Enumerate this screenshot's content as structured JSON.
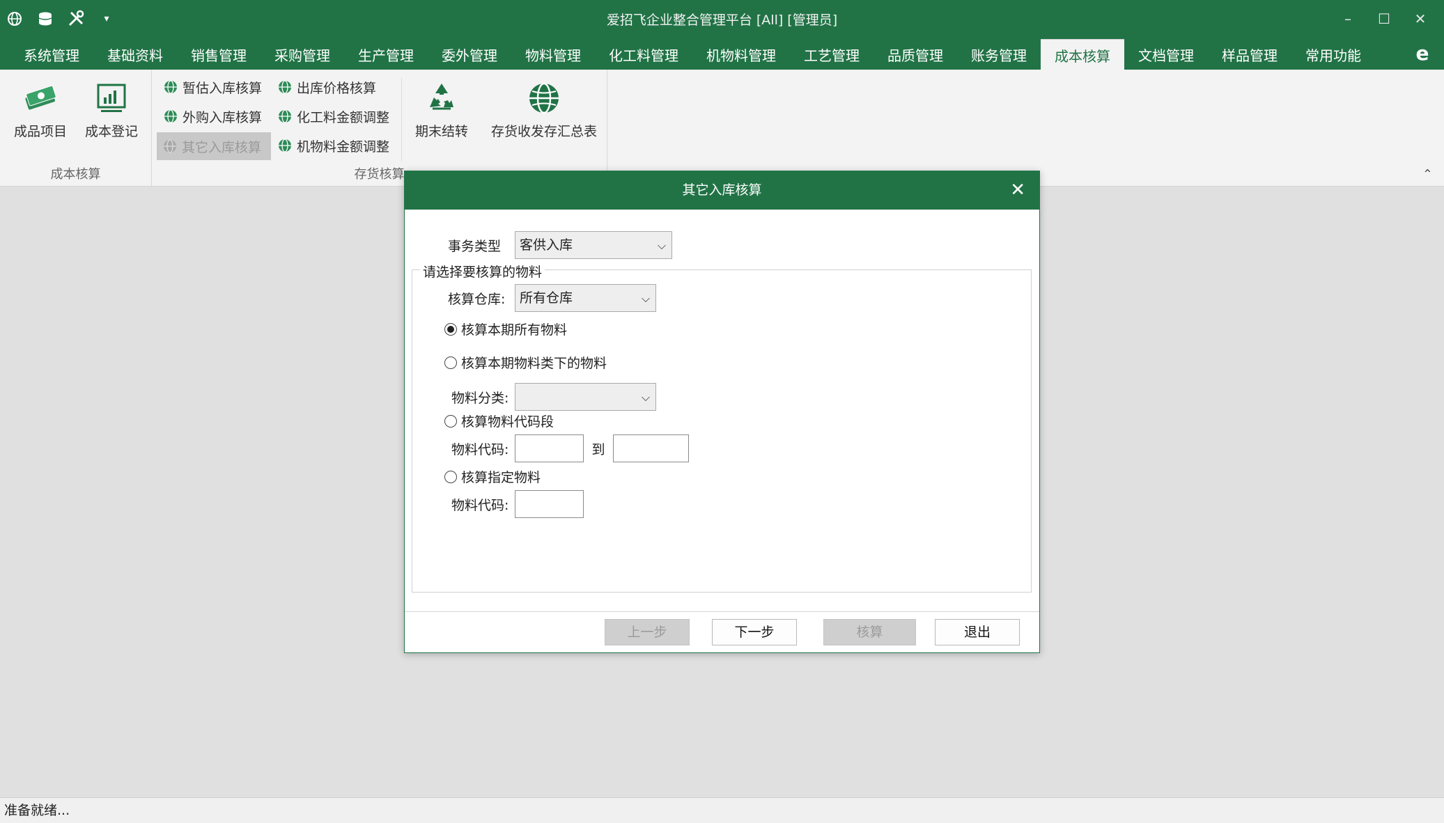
{
  "window": {
    "title": "爱招飞企业整合管理平台 [All] [管理员]",
    "controls": {
      "minimize": "–",
      "maximize": "☐",
      "close": "✕"
    }
  },
  "quick_access": [
    "globe-icon",
    "database-icon",
    "tools-icon",
    "dropdown-icon"
  ],
  "menu": {
    "tabs": [
      {
        "label": "系统管理"
      },
      {
        "label": "基础资料"
      },
      {
        "label": "销售管理"
      },
      {
        "label": "采购管理"
      },
      {
        "label": "生产管理"
      },
      {
        "label": "委外管理"
      },
      {
        "label": "物料管理"
      },
      {
        "label": "化工料管理"
      },
      {
        "label": "机物料管理"
      },
      {
        "label": "工艺管理"
      },
      {
        "label": "品质管理"
      },
      {
        "label": "账务管理"
      },
      {
        "label": "成本核算",
        "active": true
      },
      {
        "label": "文档管理"
      },
      {
        "label": "样品管理"
      },
      {
        "label": "常用功能"
      }
    ],
    "brand_glyph": "e"
  },
  "ribbon": {
    "group1": {
      "label": "成本核算",
      "buttons": [
        {
          "label": "成品项目",
          "icon": "money-icon"
        },
        {
          "label": "成本登记",
          "icon": "chart-icon"
        }
      ]
    },
    "group2": {
      "label": "存货核算",
      "small_buttons": [
        {
          "label": "暂估入库核算",
          "icon": "globe-icon"
        },
        {
          "label": "外购入库核算",
          "icon": "globe-icon"
        },
        {
          "label": "其它入库核算",
          "icon": "globe-icon",
          "disabled": true
        },
        {
          "label": "出库价格核算",
          "icon": "globe-icon"
        },
        {
          "label": "化工料金额调整",
          "icon": "globe-icon"
        },
        {
          "label": "机物料金额调整",
          "icon": "globe-icon"
        }
      ],
      "big_buttons": [
        {
          "label": "期末结转",
          "icon": "recycle-icon"
        },
        {
          "label": "存货收发存汇总表",
          "icon": "globe-icon"
        }
      ]
    },
    "collapse_glyph": "⌃"
  },
  "dialog": {
    "title": "其它入库核算",
    "close": "✕",
    "transaction_type_label": "事务类型",
    "transaction_type_value": "客供入库",
    "group_legend": "请选择要核算的物料",
    "warehouse_label": "核算仓库:",
    "warehouse_value": "所有仓库",
    "option_all": "核算本期所有物料",
    "option_category": "核算本期物料类下的物料",
    "category_label": "物料分类:",
    "category_value": "",
    "option_code_range": "核算物料代码段",
    "code_label": "物料代码:",
    "code_to": "到",
    "code_from_value": "",
    "code_to_value": "",
    "option_specified": "核算指定物料",
    "specified_code_label": "物料代码:",
    "specified_code_value": "",
    "buttons": {
      "prev": "上一步",
      "next": "下一步",
      "calc": "核算",
      "exit": "退出"
    }
  },
  "status": {
    "text": "准备就绪..."
  },
  "colors": {
    "brand": "#217346",
    "ribbon_bg": "#f3f3f3",
    "workspace": "#e0e0e0"
  }
}
